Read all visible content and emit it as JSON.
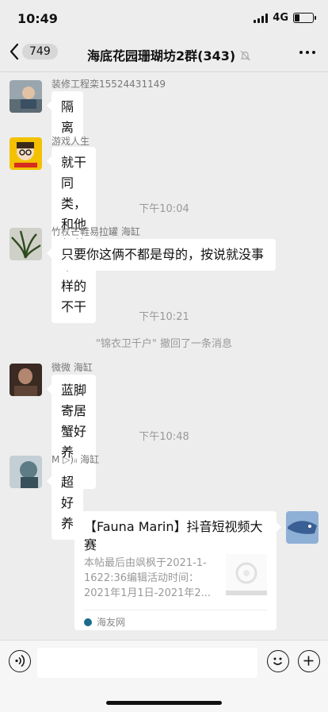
{
  "status": {
    "time": "10:49",
    "network": "4G"
  },
  "nav": {
    "back_count": "749",
    "title": "海底花园珊瑚坊2群(343)"
  },
  "messages": [
    {
      "sender": "装修工程栾15524431149",
      "text": "隔离"
    },
    {
      "sender": "游戏人生",
      "text": "就干同类，和他长的不一样的不干"
    },
    {
      "sender": "竹杖芒鞋易拉罐 海缸",
      "text": "只要你这俩不都是母的，按说就没事"
    },
    {
      "sender": "微微 海缸",
      "text": "蓝脚寄居蟹好养吗？"
    },
    {
      "sender": "M ▷)ᵢᵢ 海缸",
      "text": "超好养"
    }
  ],
  "time_separators": [
    "下午10:04",
    "下午10:21",
    "下午10:48"
  ],
  "recall_notice": "\"锦衣卫千户\" 撤回了一条消息",
  "shared_card": {
    "title": "【Fauna Marin】抖音短视频大赛",
    "description": "本帖最后由飒枫于2021-1-1622:36编辑活动时间：2021年1月1日-2021年2...",
    "source": "海友网"
  },
  "colors": {
    "background": "#ededed",
    "bubble": "#ffffff",
    "meta_text": "#999999"
  }
}
